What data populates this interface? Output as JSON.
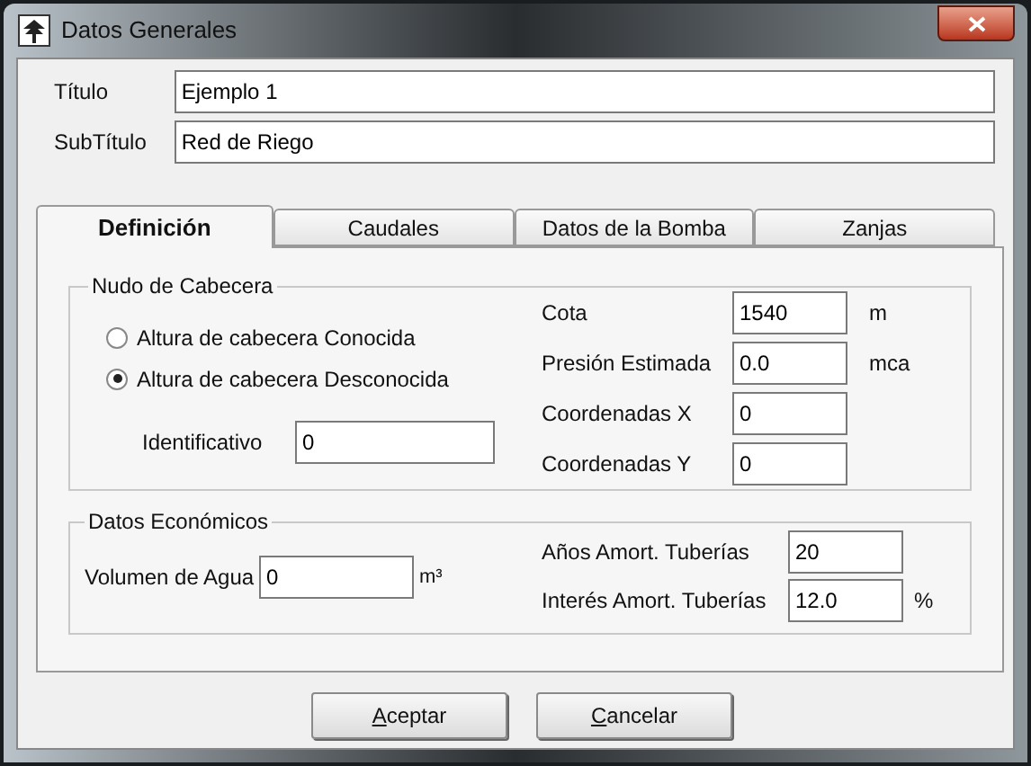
{
  "window": {
    "title": "Datos Generales"
  },
  "fields": [
    {
      "label": "Título",
      "value": "Ejemplo 1"
    },
    {
      "label": "SubTítulo",
      "value": "Red de Riego"
    }
  ],
  "tabs": [
    {
      "label": "Definición",
      "selected": true
    },
    {
      "label": "Caudales",
      "selected": false
    },
    {
      "label": "Datos de la Bomba",
      "selected": false
    },
    {
      "label": "Zanjas",
      "selected": false
    }
  ],
  "nudo": {
    "title": "Nudo de Cabecera",
    "radios": [
      {
        "label": "Altura de cabecera Conocida",
        "selected": false
      },
      {
        "label": "Altura de cabecera Desconocida",
        "selected": true
      }
    ],
    "identificativo": {
      "label": "Identificativo",
      "value": "0"
    },
    "rows": [
      {
        "label": "Cota",
        "value": "1540",
        "unit": "m"
      },
      {
        "label": "Presión Estimada",
        "value": "0.0",
        "unit": "mca"
      },
      {
        "label": "Coordenadas X",
        "value": "0"
      },
      {
        "label": "Coordenadas Y",
        "value": "0"
      }
    ]
  },
  "economicos": {
    "title": "Datos Económicos",
    "volumen": {
      "label": "Volumen de Agua",
      "value": "0",
      "unit": "m³"
    },
    "rows": [
      {
        "label": "Años Amort. Tuberías",
        "value": "20"
      },
      {
        "label": "Interés Amort. Tuberías",
        "value": "12.0",
        "unit": "%"
      }
    ]
  },
  "buttons": [
    "Aceptar",
    "Cancelar"
  ]
}
